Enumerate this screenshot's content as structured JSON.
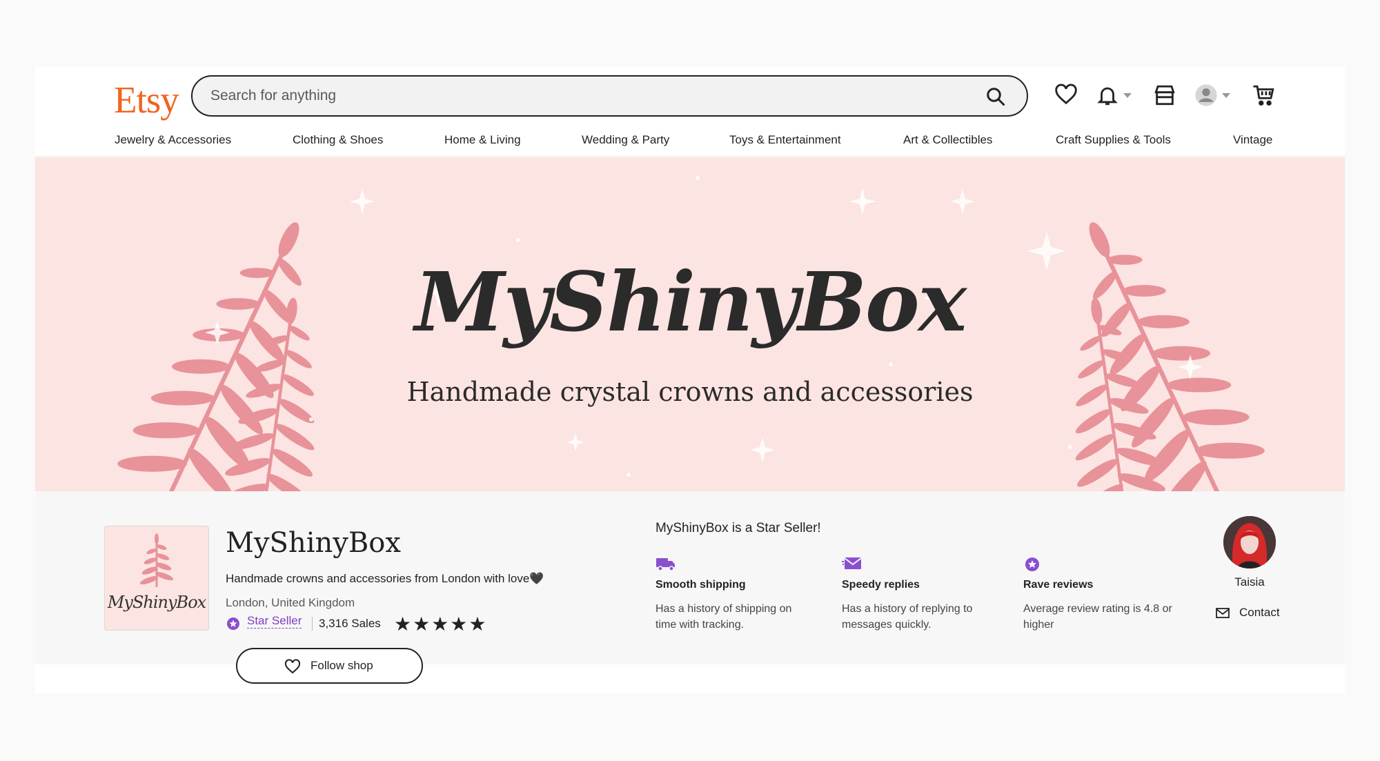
{
  "header": {
    "logo": "Etsy",
    "search_placeholder": "Search for anything"
  },
  "categories": [
    "Jewelry & Accessories",
    "Clothing & Shoes",
    "Home & Living",
    "Wedding & Party",
    "Toys & Entertainment",
    "Art & Collectibles",
    "Craft Supplies & Tools",
    "Vintage"
  ],
  "banner": {
    "title": "MyShinyBox",
    "subtitle": "Handmade crystal crowns and accessories"
  },
  "shop": {
    "logo_text": "MyShinyBox",
    "name": "MyShinyBox",
    "tagline": "Handmade crowns and accessories from London with love🖤",
    "location": "London, United Kingdom",
    "badge": "Star Seller",
    "sales": "3,316 Sales",
    "rating_stars": 5,
    "stars_text": "★★★★★",
    "follow_label": "Follow shop"
  },
  "star_seller": {
    "title": "MyShinyBox is a Star Seller!",
    "features": [
      {
        "icon": "truck-icon",
        "heading": "Smooth shipping",
        "desc": "Has a history of shipping on time with tracking."
      },
      {
        "icon": "envelope-icon",
        "heading": "Speedy replies",
        "desc": "Has a history of replying to messages quickly."
      },
      {
        "icon": "star-badge-icon",
        "heading": "Rave reviews",
        "desc": "Average review rating is 4.8 or higher"
      }
    ]
  },
  "owner": {
    "name": "Taisia",
    "contact_label": "Contact"
  },
  "colors": {
    "brand": "#f1641e",
    "star_seller": "#7f3fbf",
    "banner_bg": "#fbe4e1",
    "fern": "#e8929a"
  }
}
